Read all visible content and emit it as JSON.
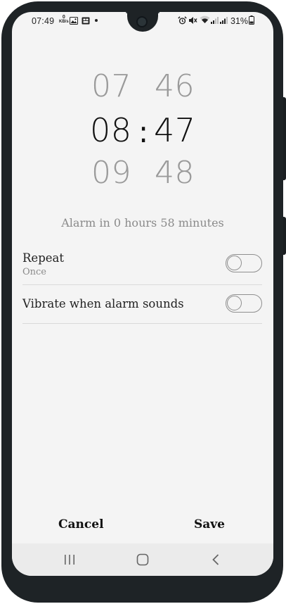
{
  "status_bar": {
    "time": "07:49",
    "net_speed_value": "0",
    "net_speed_unit": "KB/s",
    "battery_percent": "31%"
  },
  "picker": {
    "hour_prev": "07",
    "hour_selected": "08",
    "hour_next": "09",
    "separator": ":",
    "minute_prev": "46",
    "minute_selected": "47",
    "minute_next": "48"
  },
  "alarm_in": "Alarm in 0 hours 58 minutes",
  "settings": {
    "repeat": {
      "title": "Repeat",
      "subtitle": "Once",
      "enabled": false
    },
    "vibrate": {
      "title": "Vibrate when alarm sounds",
      "enabled": false
    }
  },
  "footer": {
    "cancel_label": "Cancel",
    "save_label": "Save"
  },
  "nav_bar": {
    "icons": [
      "recent-apps-icon",
      "home-icon",
      "back-icon"
    ]
  },
  "colors": {
    "background": "#f4f4f4",
    "text_primary": "#111111",
    "text_secondary": "#8a8a8a",
    "frame": "#1e2326"
  }
}
